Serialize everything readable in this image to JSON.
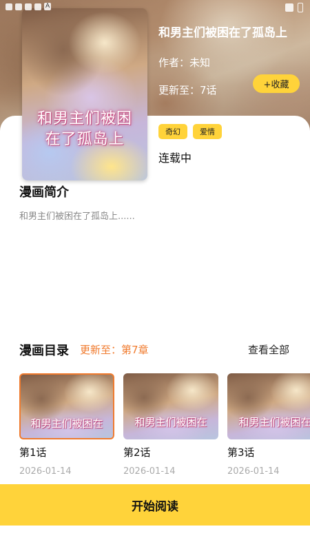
{
  "status_bar": {
    "indicator": "A"
  },
  "comic": {
    "title": "和男主们被困在了孤岛上",
    "author": "作者：未知",
    "update": "更新至：7话",
    "collect_label": "+收藏",
    "tags": [
      "奇幻",
      "爱情"
    ],
    "status": "连载中",
    "cover_title": "和男主们被困在了孤岛上"
  },
  "intro": {
    "title": "漫画简介",
    "text": "和男主们被困在了孤岛上......"
  },
  "catalog": {
    "title": "漫画目录",
    "update": "更新至：第7章",
    "view_all": "查看全部",
    "chapters": [
      {
        "name": "第1话",
        "date": "2026-01-14",
        "thumb_text": "和男主们被困在"
      },
      {
        "name": "第2话",
        "date": "2026-01-14",
        "thumb_text": "和男主们被困在"
      },
      {
        "name": "第3话",
        "date": "2026-01-14",
        "thumb_text": "和男主们被困在"
      }
    ]
  },
  "read_button": "开始阅读",
  "colors": {
    "accent": "#ffd33a",
    "highlight": "#f07a2d"
  }
}
